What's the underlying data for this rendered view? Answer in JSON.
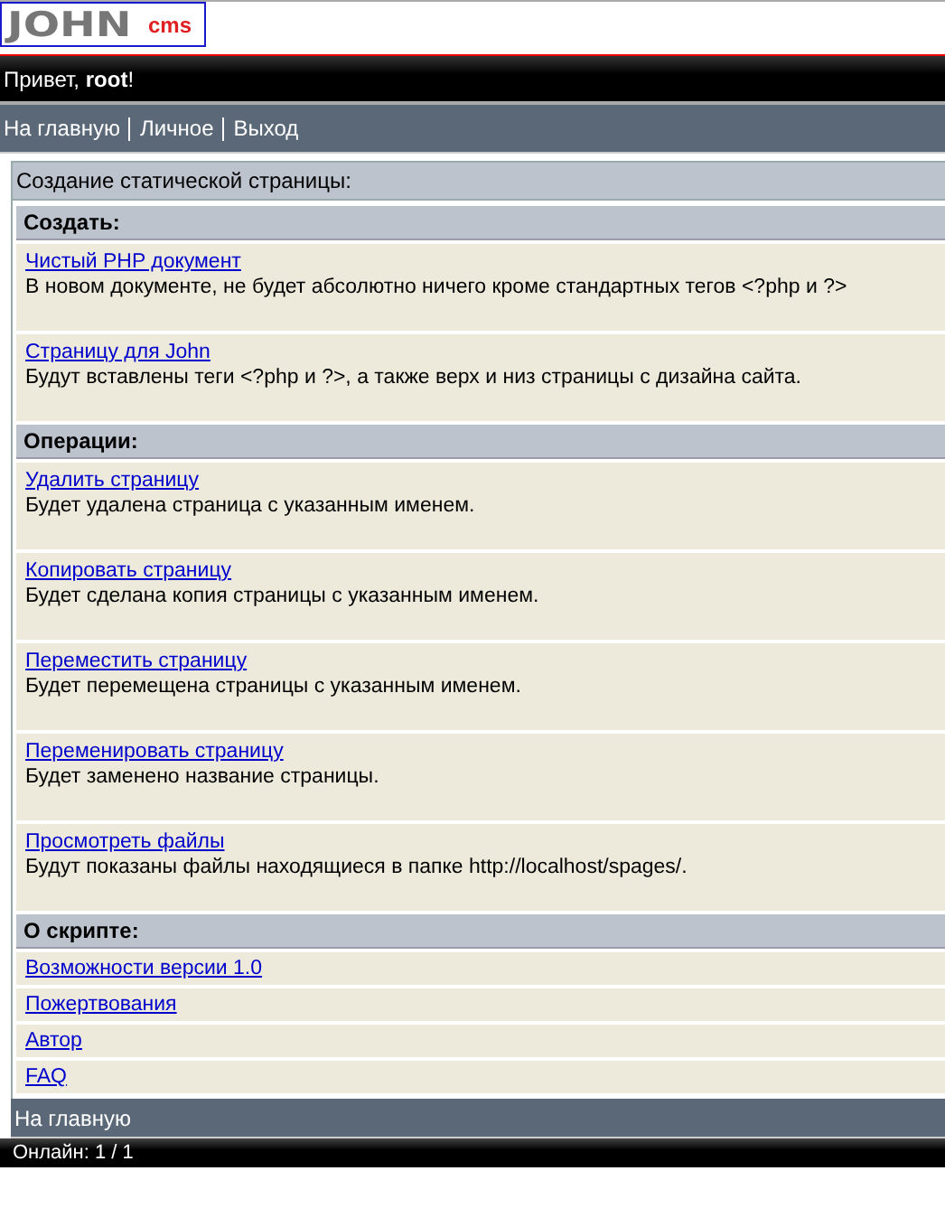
{
  "logo": {
    "main": "JOHN",
    "suffix": "cms"
  },
  "greeting": "Привет, **root**!",
  "nav": [
    "На главную",
    "Личное",
    "Выход"
  ],
  "page_title": "Создание статической страницы:",
  "sections": [
    {
      "title": "Создать:",
      "items": [
        {
          "link": "Чистый PHP документ",
          "description": "В новом документе, не будет абсолютно ничего кроме стандартных тегов <?php и ?>"
        },
        {
          "link": "Страницу для John",
          "description": "Будут вставлены теги <?php и ?>, а также верх и низ страницы с дизайна сайта."
        }
      ]
    },
    {
      "title": "Операции:",
      "items": [
        {
          "link": "Удалить страницу",
          "description": "Будет удалена страница с указанным именем."
        },
        {
          "link": "Копировать страницу",
          "description": "Будет сделана копия страницы с указанным именем."
        },
        {
          "link": "Переместить страницу",
          "description": "Будет перемещена страницы с указанным именем."
        },
        {
          "link": "Переменировать страницу",
          "description": "Будет заменено название страницы."
        },
        {
          "link": "Просмотреть файлы",
          "description": "Будут показаны файлы находящиеся в папке http://localhost/spages/."
        }
      ]
    },
    {
      "title": "О скрипте:",
      "items": [
        {
          "link": "Возможности версии 1.0"
        },
        {
          "link": "Пожертвования"
        },
        {
          "link": "Автор"
        },
        {
          "link": "FAQ"
        }
      ]
    }
  ],
  "footer_link": "На главную",
  "online": "Онлайн: 1 / 1"
}
